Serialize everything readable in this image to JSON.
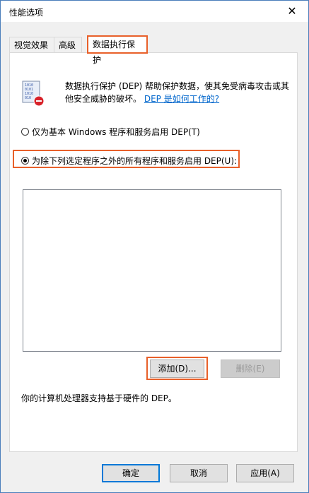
{
  "window": {
    "title": "性能选项",
    "close_icon": "close-icon"
  },
  "tabs": [
    {
      "label": "视觉效果",
      "active": false
    },
    {
      "label": "高级",
      "active": false
    },
    {
      "label": "数据执行保护",
      "active": true
    }
  ],
  "description": {
    "text": "数据执行保护 (DEP) 帮助保护数据，使其免受病毒攻击或其他安全威胁的破坏。",
    "link": "DEP 是如何工作的?"
  },
  "options": {
    "essential_only": {
      "label": "仅为基本 Windows 程序和服务启用 DEP(T)",
      "checked": false
    },
    "all_except": {
      "label": "为除下列选定程序之外的所有程序和服务启用 DEP(U):",
      "checked": true
    }
  },
  "list": {
    "items": []
  },
  "buttons": {
    "add": "添加(D)...",
    "remove": "删除(E)",
    "ok": "确定",
    "cancel": "取消",
    "apply": "应用(A)"
  },
  "hardware_note": "你的计算机处理器支持基于硬件的 DEP。",
  "colors": {
    "highlight": "#e8602a",
    "link": "#0066cc",
    "accent": "#0078d7"
  }
}
